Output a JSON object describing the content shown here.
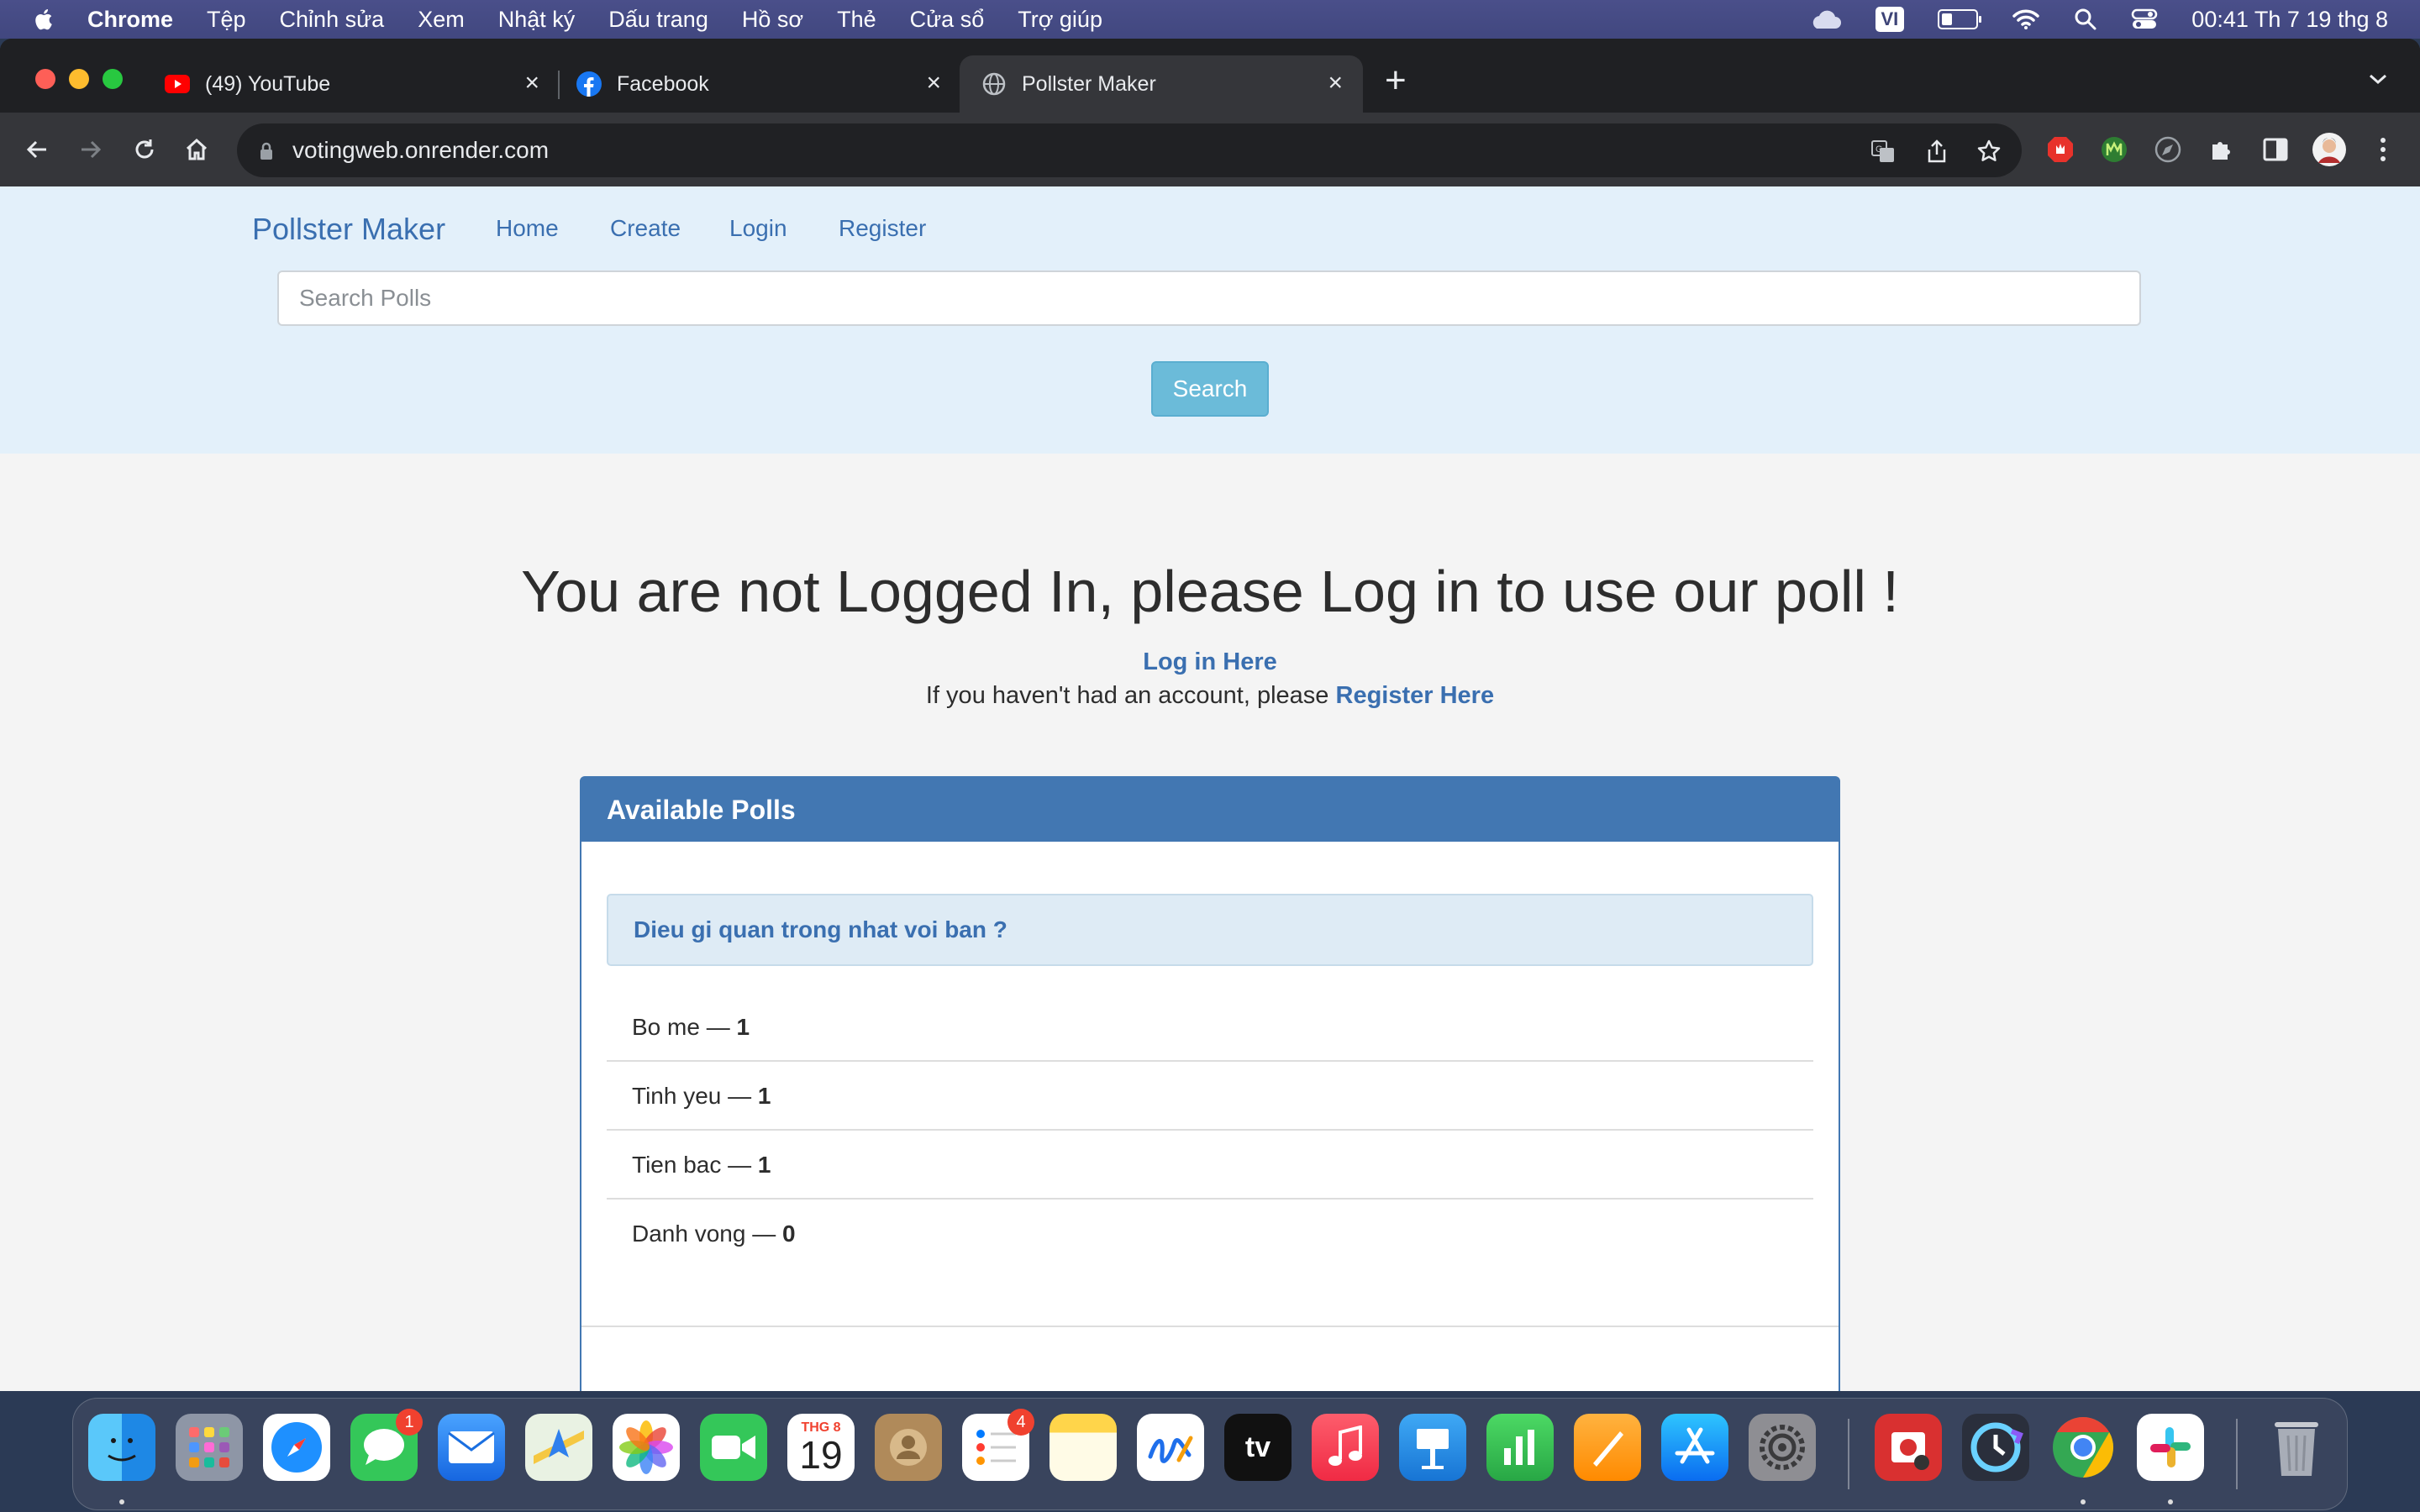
{
  "menubar": {
    "app": "Chrome",
    "items": [
      "Tệp",
      "Chỉnh sửa",
      "Xem",
      "Nhật ký",
      "Dấu trang",
      "Hồ sơ",
      "Thẻ",
      "Cửa sổ",
      "Trợ giúp"
    ],
    "input_source": "VI",
    "clock": "00:41 Th 7 19 thg 8"
  },
  "browser": {
    "tabs": [
      {
        "title": "(49) YouTube",
        "icon": "youtube-icon"
      },
      {
        "title": "Facebook",
        "icon": "facebook-icon"
      },
      {
        "title": "Pollster Maker",
        "icon": "globe-icon",
        "active": true
      }
    ],
    "url": "votingweb.onrender.com"
  },
  "site": {
    "brand": "Pollster Maker",
    "nav": [
      "Home",
      "Create",
      "Login",
      "Register"
    ],
    "search_placeholder": "Search Polls",
    "search_button": "Search"
  },
  "main": {
    "headline": "You are not Logged In, please Log in to use our poll !",
    "login_link": "Log in Here",
    "register_prefix": "If you haven't had an account, please ",
    "register_link": "Register Here"
  },
  "polls": {
    "title": "Available Polls",
    "question": "Dieu gi quan trong nhat voi ban ?",
    "options": [
      {
        "label": "Bo me",
        "sep": " — ",
        "count": "1"
      },
      {
        "label": "Tinh yeu",
        "sep": " — ",
        "count": "1"
      },
      {
        "label": "Tien bac",
        "sep": " — ",
        "count": "1"
      },
      {
        "label": "Danh vong",
        "sep": " — ",
        "count": "0"
      }
    ]
  },
  "dock": {
    "calendar_month": "THG 8",
    "calendar_day": "19",
    "messages_badge": "1",
    "reminders_badge": "4",
    "apps": [
      "finder-icon",
      "launchpad-icon",
      "safari-icon",
      "messages-icon",
      "mail-icon",
      "maps-icon",
      "photos-icon",
      "facetime-icon",
      "calendar-icon",
      "contacts-icon",
      "reminders-icon",
      "notes-icon",
      "freeform-icon",
      "appletv-icon",
      "music-icon",
      "keynote-icon",
      "numbers-icon",
      "pages-icon",
      "appstore-icon",
      "settings-icon",
      "photobooth-icon",
      "screentime-icon",
      "chrome-icon",
      "slack-icon",
      "trash-icon"
    ]
  },
  "colors": {
    "brand_blue": "#3a6fb0",
    "panel_header": "#4277b2",
    "nav_bg": "#e3f0fa",
    "search_button": "#6bbbd9"
  }
}
